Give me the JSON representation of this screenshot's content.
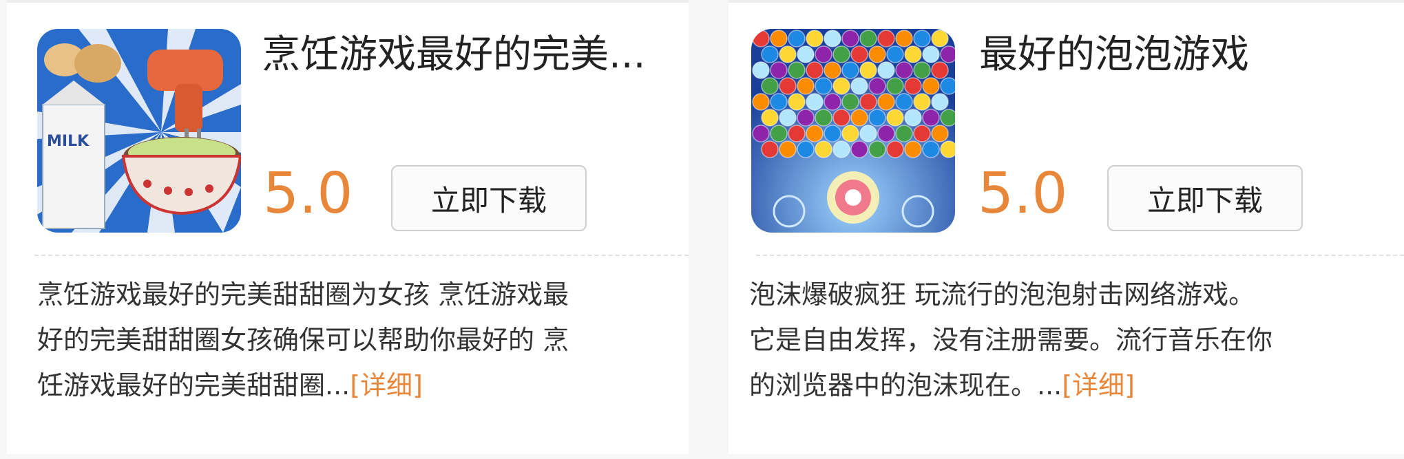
{
  "apps": [
    {
      "title": "烹饪游戏最好的完美...",
      "rating": "5.0",
      "download_label": "立即下载",
      "desc_lines": [
        "烹饪游戏最好的完美甜甜圈为女孩 烹饪游戏最",
        "好的完美甜甜圈女孩确保可以帮助你最好的 烹",
        "饪游戏最好的完美甜甜圈..."
      ],
      "more_label": "[详细]",
      "icon_name": "cooking-game-icon",
      "icon_text": "MILK"
    },
    {
      "title": "最好的泡泡游戏",
      "rating": "5.0",
      "download_label": "立即下载",
      "desc_lines": [
        "泡沫爆破疯狂 玩流行的泡泡射击网络游戏。",
        " 它是自由发挥，没有注册需要。流行音乐在你",
        "的浏览器中的泡沫现在。..."
      ],
      "more_label": "[详细]",
      "icon_name": "bubble-game-icon"
    }
  ],
  "colors": {
    "rating": "#e8873a",
    "more_link": "#e8873a",
    "button_border": "#cfcfcf"
  }
}
